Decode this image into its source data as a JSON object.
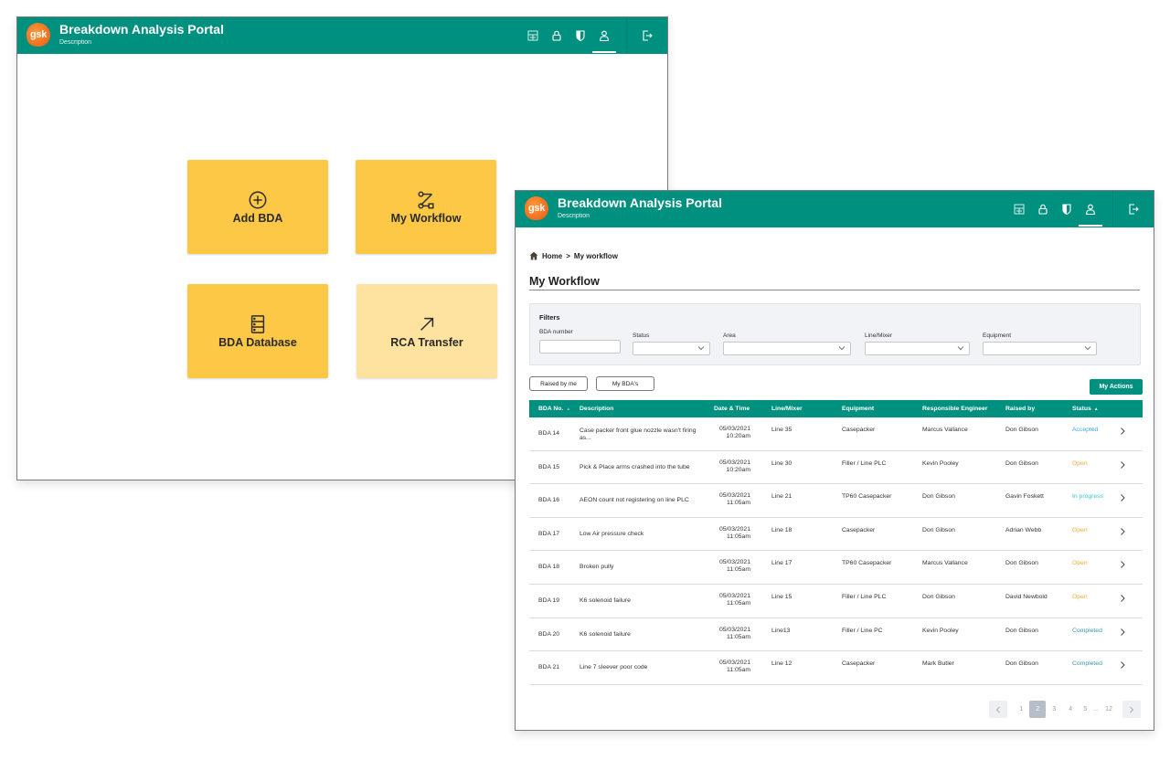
{
  "app": {
    "title": "Breakdown Analysis Portal",
    "subtitle": "Description",
    "logo_text": "gsk",
    "brand_color": "#00907f",
    "nav_icons": [
      "dashboard-icon",
      "lock-icon",
      "shield-icon",
      "user-icon"
    ],
    "active_nav": "user-icon",
    "logout_icon": "logout-icon"
  },
  "home": {
    "tiles": [
      {
        "label": "Add BDA",
        "icon": "plus-circle-icon",
        "enabled": true
      },
      {
        "label": "My Workflow",
        "icon": "workflow-icon",
        "enabled": true
      },
      {
        "label": "BDA Database",
        "icon": "database-icon",
        "enabled": true
      },
      {
        "label": "RCA Transfer",
        "icon": "arrow-up-right-icon",
        "enabled": false
      }
    ]
  },
  "workflow": {
    "breadcrumb": {
      "home": "Home",
      "separator": ">",
      "current": "My workflow"
    },
    "page_title": "My Workflow",
    "filters": {
      "heading": "Filters",
      "bda_number": {
        "label": "BDA number",
        "value": "",
        "placeholder": ""
      },
      "status": {
        "label": "Status",
        "value": ""
      },
      "area": {
        "label": "Area",
        "value": ""
      },
      "line_mixer": {
        "label": "Line/Mixer",
        "value": ""
      },
      "equipment": {
        "label": "Equipment",
        "value": ""
      }
    },
    "quick_filters": [
      "Raised by me",
      "My BDA's"
    ],
    "actions_button": "My Actions",
    "columns": [
      "BDA No.",
      "Description",
      "Date & Time",
      "Line/Mixer",
      "Equipment",
      "Responsible Engineer",
      "Raised by",
      "Status"
    ],
    "sort_indicator": "▲",
    "status_colors": {
      "Accepted": "#3aa7e8",
      "Open": "#f2a93b",
      "In progress": "#35c9cc",
      "Completed": "#3a98a8"
    },
    "rows": [
      {
        "no": "BDA 14",
        "desc": "Case packer front glue nozzle wasn't firing as...",
        "date": "05/03/2021",
        "time": "10:20am",
        "line": "Line 35",
        "equipment": "Casepacker",
        "engineer": "Marcus Vallance",
        "raised_by": "Don Gibson",
        "status": "Accepted"
      },
      {
        "no": "BDA 15",
        "desc": "Pick & Place arms crashed into the tube",
        "date": "05/03/2021",
        "time": "10:20am",
        "line": "Line 30",
        "equipment": "Filler / Line PLC",
        "engineer": "Kevin Pooley",
        "raised_by": "Don Gibson",
        "status": "Open"
      },
      {
        "no": "BDA 16",
        "desc": "AEON count not registering on line PLC",
        "date": "05/03/2021",
        "time": "11:05am",
        "line": "Line 21",
        "equipment": "TP60 Casepacker",
        "engineer": "Don Gibson",
        "raised_by": "Gavin Foskett",
        "status": "In progress"
      },
      {
        "no": "BDA 17",
        "desc": "Low Air pressure check",
        "date": "05/03/2021",
        "time": "11:05am",
        "line": "Line 18",
        "equipment": "Casepacker",
        "engineer": "Don Gibson",
        "raised_by": "Adrian Webb",
        "status": "Open"
      },
      {
        "no": "BDA 18",
        "desc": "Broken pully",
        "date": "05/03/2021",
        "time": "11:05am",
        "line": "Line 17",
        "equipment": "TP60 Casepacker",
        "engineer": "Marcus Vallance",
        "raised_by": "Don Gibson",
        "status": "Open"
      },
      {
        "no": "BDA 19",
        "desc": "K6 solenoid failure",
        "date": "05/03/2021",
        "time": "11:05am",
        "line": "Line 15",
        "equipment": "Filler / Line PLC",
        "engineer": "Don Gibson",
        "raised_by": "David Newbold",
        "status": "Open"
      },
      {
        "no": "BDA 20",
        "desc": "K6 solenoid failure",
        "date": "05/03/2021",
        "time": "11:05am",
        "line": "Line13",
        "equipment": "Filler / Line PC",
        "engineer": "Kevin Pooley",
        "raised_by": "Don Gibson",
        "status": "Completed"
      },
      {
        "no": "BDA 21",
        "desc": "Line 7 sleever poor code",
        "date": "05/03/2021",
        "time": "11:05am",
        "line": "Line 12",
        "equipment": "Casepacker",
        "engineer": "Mark Butler",
        "raised_by": "Don Gibson",
        "status": "Completed"
      }
    ],
    "pagination": {
      "pages": [
        "1",
        "2",
        "3",
        "4",
        "5"
      ],
      "ellipsis": "...",
      "last": "12",
      "current": "2"
    }
  }
}
